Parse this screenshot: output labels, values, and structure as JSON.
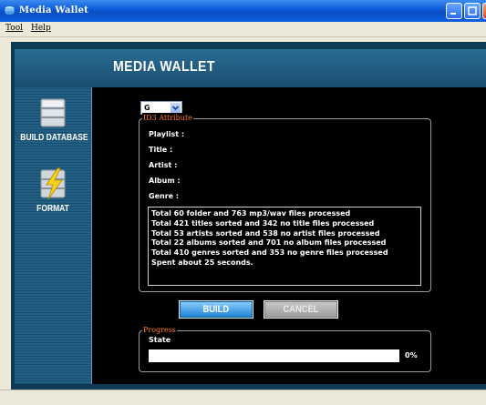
{
  "window": {
    "title": "Media Wallet"
  },
  "menu": {
    "items": [
      "Tool",
      "Help"
    ]
  },
  "brand": "MEDIA WALLET",
  "sidebar": {
    "items": [
      {
        "label": "BUILD DATABASE",
        "icon": "database-icon"
      },
      {
        "label": "FORMAT",
        "icon": "database-lightning-icon"
      }
    ]
  },
  "drive": {
    "value": "G"
  },
  "id3": {
    "legend": "ID3 Attribute",
    "fields": [
      "Playlist :",
      "Title :",
      "Artist :",
      "Album :",
      "Genre :"
    ],
    "log": [
      "Total 60 folder and 763 mp3/wav files processed",
      "Total 421 titles sorted and 342 no title files processed",
      "Total 53 artists sorted and 538 no artist files processed",
      "Total 22 albums sorted and 701 no album files processed",
      "Total 410 genres sorted and 353 no genre files processed",
      "Spent about 25 seconds."
    ]
  },
  "buttons": {
    "build": "BUILD",
    "cancel": "CANCEL"
  },
  "progress": {
    "legend": "Progress",
    "state_label": "State",
    "percent_text": "0%",
    "value": 0
  },
  "colors": {
    "accent": "#1a80d4",
    "legend": "#ff7a1f",
    "sidebar": "#215f84"
  }
}
